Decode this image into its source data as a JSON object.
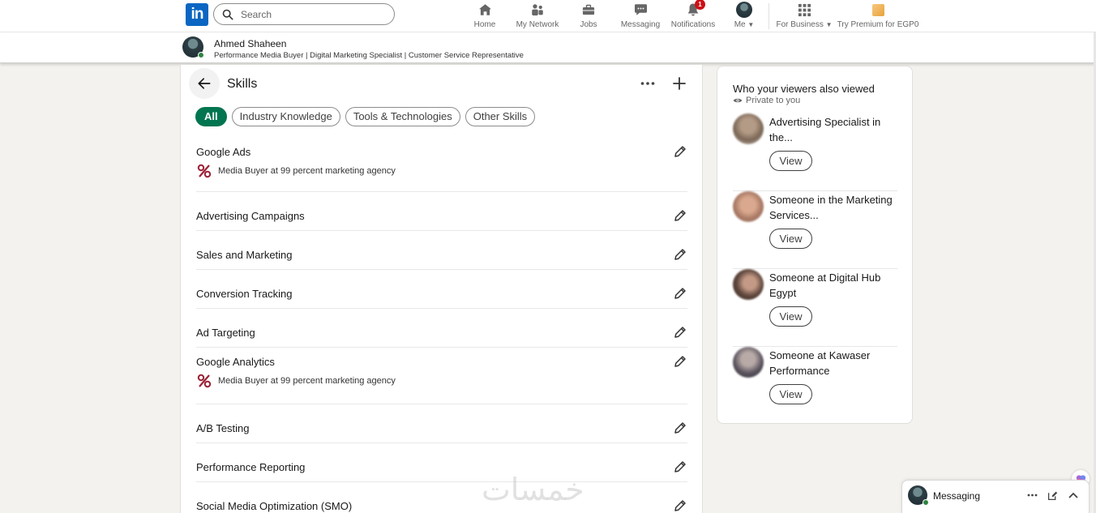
{
  "nav": {
    "logo_text": "in",
    "search_placeholder": "Search",
    "items": [
      {
        "label": "Home",
        "icon": "home-icon"
      },
      {
        "label": "My Network",
        "icon": "network-icon"
      },
      {
        "label": "Jobs",
        "icon": "briefcase-icon"
      },
      {
        "label": "Messaging",
        "icon": "messaging-icon"
      },
      {
        "label": "Notifications",
        "icon": "bell-icon",
        "badge": "1"
      },
      {
        "label": "Me",
        "icon": "avatar"
      },
      {
        "label": "For Business",
        "icon": "grid-icon"
      },
      {
        "label": "Try Premium for EGP0",
        "icon": "premium-icon"
      }
    ]
  },
  "profile_bar": {
    "name": "Ahmed Shaheen",
    "headline": "Performance Media Buyer | Digital Marketing Specialist | Customer Service Representative"
  },
  "skills_page": {
    "title": "Skills",
    "filters": [
      "All",
      "Industry Knowledge",
      "Tools & Technologies",
      "Other Skills"
    ],
    "active_filter": "All",
    "skills": [
      {
        "name": "Google Ads",
        "context": "Media Buyer at 99 percent marketing agency"
      },
      {
        "name": "Advertising Campaigns",
        "context": ""
      },
      {
        "name": "Sales and Marketing",
        "context": ""
      },
      {
        "name": "Conversion Tracking",
        "context": ""
      },
      {
        "name": "Ad Targeting",
        "context": ""
      },
      {
        "name": "Google Analytics",
        "context": "Media Buyer at 99 percent marketing agency"
      },
      {
        "name": "A/B Testing",
        "context": ""
      },
      {
        "name": "Performance Reporting",
        "context": ""
      },
      {
        "name": "Social Media Optimization (SMO)",
        "context": ""
      }
    ]
  },
  "sidebar": {
    "title": "Who your viewers also viewed",
    "privacy": "Private to you",
    "viewers": [
      {
        "name": "Advertising Specialist in the...",
        "button": "View"
      },
      {
        "name": "Someone in the Marketing Services...",
        "button": "View"
      },
      {
        "name": "Someone at Digital Hub Egypt",
        "button": "View"
      },
      {
        "name": "Someone at Kawaser Performance",
        "button": "View"
      }
    ]
  },
  "messaging": {
    "label": "Messaging"
  },
  "watermark": "خمسات",
  "colors": {
    "brand": "#0a66c2",
    "active_pill": "#01754f",
    "background": "#f4f2ee",
    "badge": "#cc1016"
  }
}
